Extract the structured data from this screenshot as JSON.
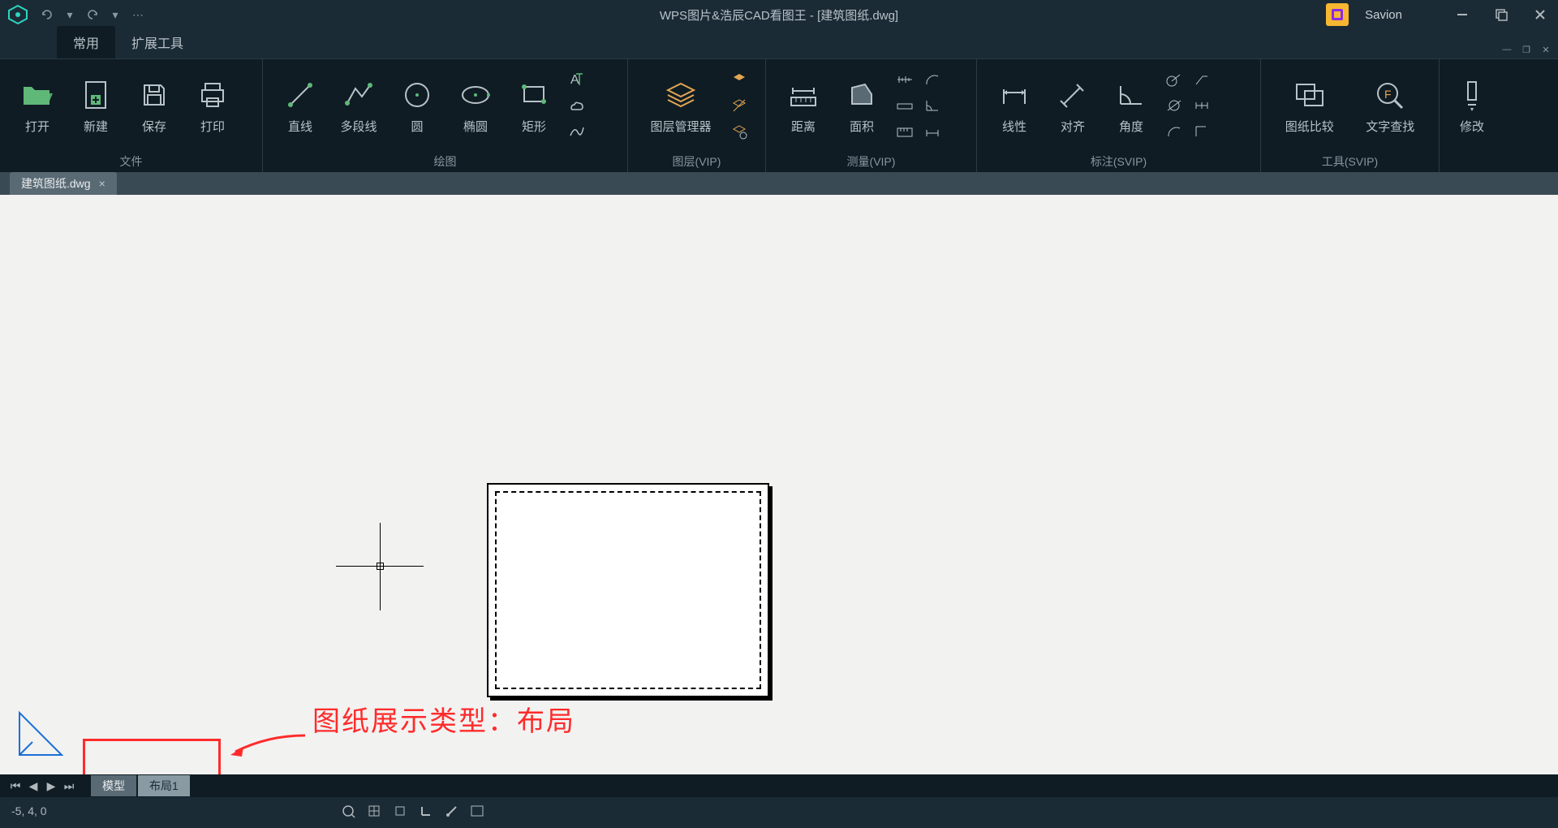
{
  "titlebar": {
    "title": "WPS图片&浩辰CAD看图王 - [建筑图纸.dwg]",
    "username": "Savion"
  },
  "menus": {
    "common": "常用",
    "extend": "扩展工具"
  },
  "ribbon": {
    "file": {
      "label": "文件",
      "open": "打开",
      "new": "新建",
      "save": "保存",
      "print": "打印"
    },
    "draw": {
      "label": "绘图",
      "line": "直线",
      "pline": "多段线",
      "circle": "圆",
      "ellipse": "椭圆",
      "rect": "矩形"
    },
    "layer": {
      "label": "图层(VIP)",
      "manager": "图层管理器"
    },
    "measure": {
      "label": "测量(VIP)",
      "dist": "距离",
      "area": "面积"
    },
    "dim": {
      "label": "标注(SVIP)",
      "linear": "线性",
      "align": "对齐",
      "angle": "角度"
    },
    "tools": {
      "label": "工具(SVIP)",
      "compare": "图纸比较",
      "textfind": "文字查找"
    },
    "modify": {
      "label": "",
      "modify": "修改"
    }
  },
  "file_tab": {
    "name": "建筑图纸.dwg"
  },
  "layout_tabs": {
    "model": "模型",
    "layout1": "布局1"
  },
  "status": {
    "coords": "-5, 4, 0"
  },
  "annotation": {
    "text": "图纸展示类型：布局"
  }
}
